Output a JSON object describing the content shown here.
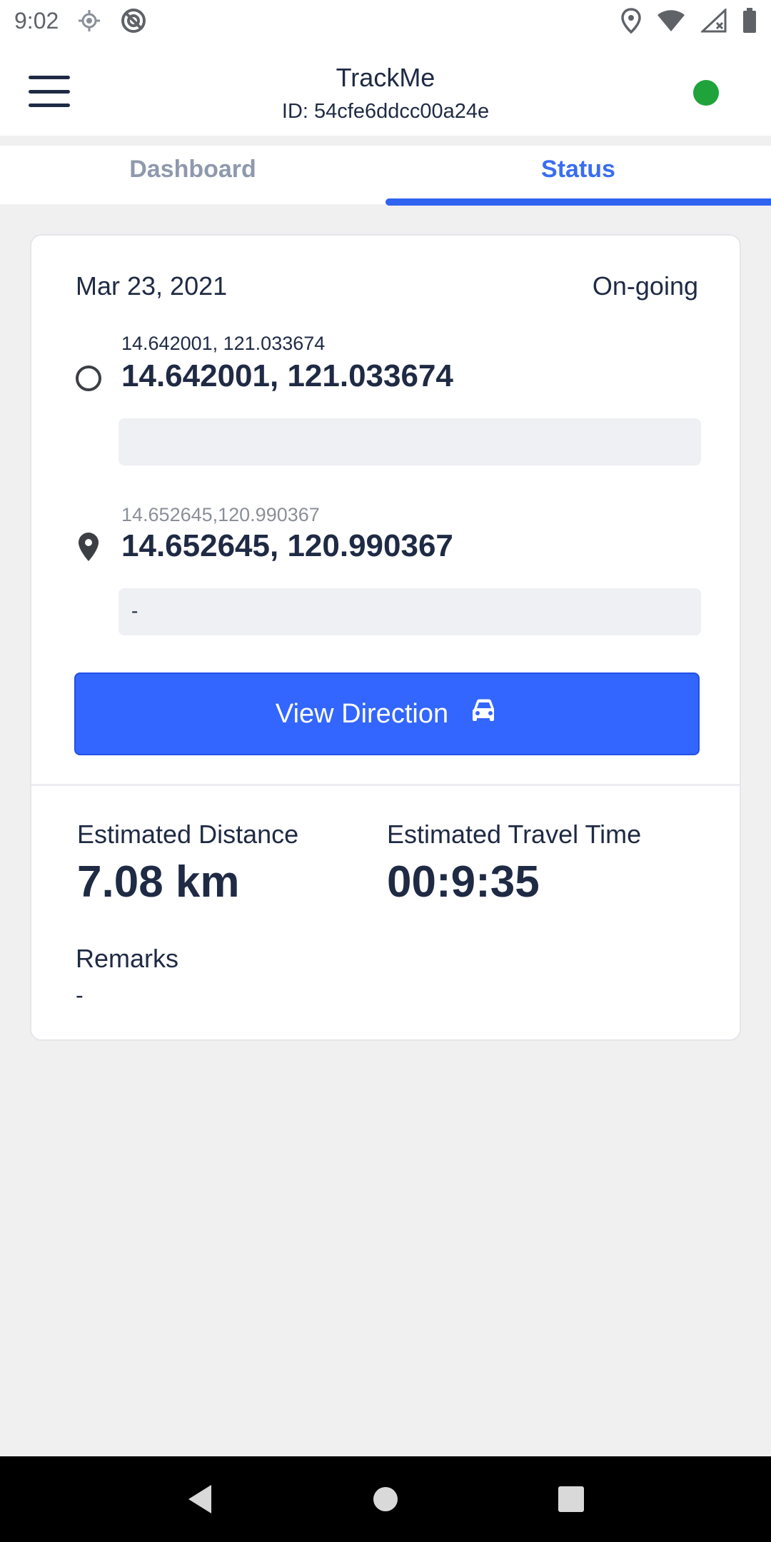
{
  "status_bar": {
    "time": "9:02",
    "left_icons": [
      "location-target-icon",
      "no-sync-icon"
    ],
    "right_icons": [
      "location-pin-icon",
      "wifi-icon",
      "no-signal-icon",
      "battery-icon"
    ]
  },
  "header": {
    "title": "TrackMe",
    "id_text": "ID: 54cfe6ddcc00a24e",
    "online_color": "#1fa33a"
  },
  "tabs": [
    {
      "label": "Dashboard",
      "active": false
    },
    {
      "label": "Status",
      "active": true
    }
  ],
  "trip": {
    "date": "Mar 23, 2021",
    "status": "On-going",
    "origin": {
      "subtitle": "14.642001, 121.033674",
      "title": "14.642001, 121.033674",
      "detail": ""
    },
    "destination": {
      "subtitle": "14.652645,120.990367",
      "title": "14.652645, 120.990367",
      "detail": "-"
    },
    "view_direction_label": "View Direction",
    "estimated_distance_label": "Estimated Distance",
    "estimated_distance_value": "7.08 km",
    "estimated_time_label": "Estimated Travel Time",
    "estimated_time_value": "00:9:35",
    "remarks_label": "Remarks",
    "remarks_value": "-"
  },
  "colors": {
    "accent": "#3366ff",
    "tab_active": "#3a6df0",
    "tab_inactive": "#8f99ad",
    "text_dark": "#1f2a44"
  }
}
